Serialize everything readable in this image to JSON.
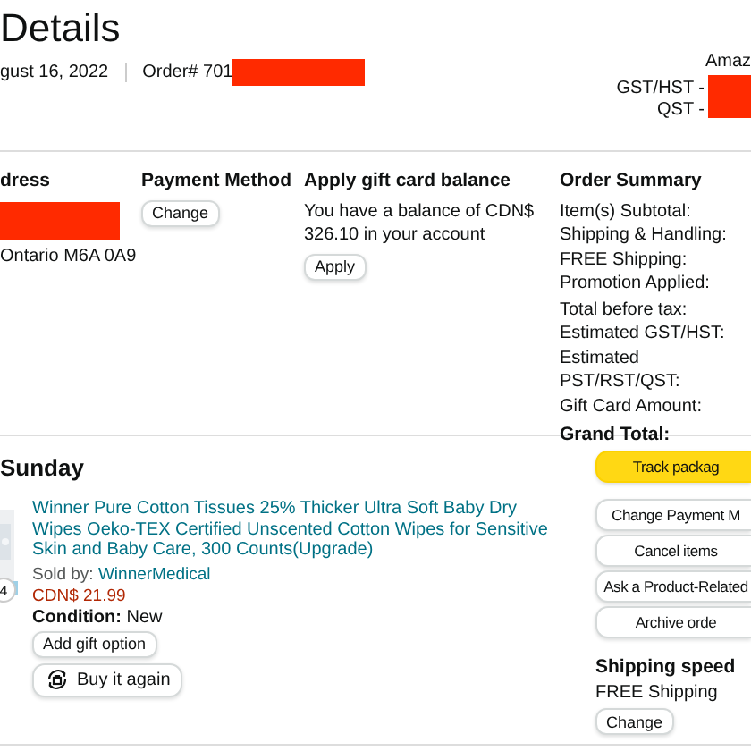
{
  "header": {
    "title": "Details",
    "order_date": "gust 16, 2022",
    "order_number": "Order# 701",
    "seller": "Amaz",
    "tax_ids": [
      "GST/HST -",
      "QST -"
    ]
  },
  "address": {
    "heading": "dress",
    "line": "Ontario M6A 0A9"
  },
  "payment": {
    "heading": "Payment Method",
    "button": "Change"
  },
  "gift_card": {
    "heading": "Apply gift card balance",
    "text": "You have a balance of CDN$ 326.10 in your account",
    "button": "Apply"
  },
  "order_summary": {
    "heading": "Order Summary",
    "groups": [
      [
        "Item(s) Subtotal:",
        "Shipping & Handling:",
        "FREE Shipping:",
        "Promotion Applied:"
      ],
      [
        "Total before tax:",
        "Estimated GST/HST:",
        "Estimated PST/RST/QST:",
        "Gift Card Amount:"
      ]
    ],
    "total": "Grand Total:"
  },
  "shipment": {
    "heading": "Sunday",
    "item": {
      "kind": "picture",
      "title": "Winner Pure Cotton Tissues 25% Thicker Ultra Soft Baby Dry Wipes Oeko-TEX Certified Unscented Cotton Wipes for Sensitive Skin and Baby Care, 300 Counts(Upgrade)",
      "quantity": "4",
      "sold_by": "Sold by:",
      "seller": "WinnerMedical",
      "price": "CDN$ 21.99",
      "condition": "**Condition:** New",
      "gift_button": "Add gift option",
      "buy_again_button": "Buy it again"
    },
    "actions": [
      {
        "label": "Track packag",
        "kind": "primary"
      },
      {
        "label": "Change Payment M",
        "kind": "secondary"
      },
      {
        "label": "Cancel items",
        "kind": "secondary"
      },
      {
        "label": "Ask a Product-Related",
        "kind": "secondary"
      },
      {
        "label": "Archive orde",
        "kind": "secondary"
      }
    ],
    "shipping_speed": {
      "heading": "Shipping speed",
      "value": "FREE Shipping",
      "button": "Change"
    }
  }
}
